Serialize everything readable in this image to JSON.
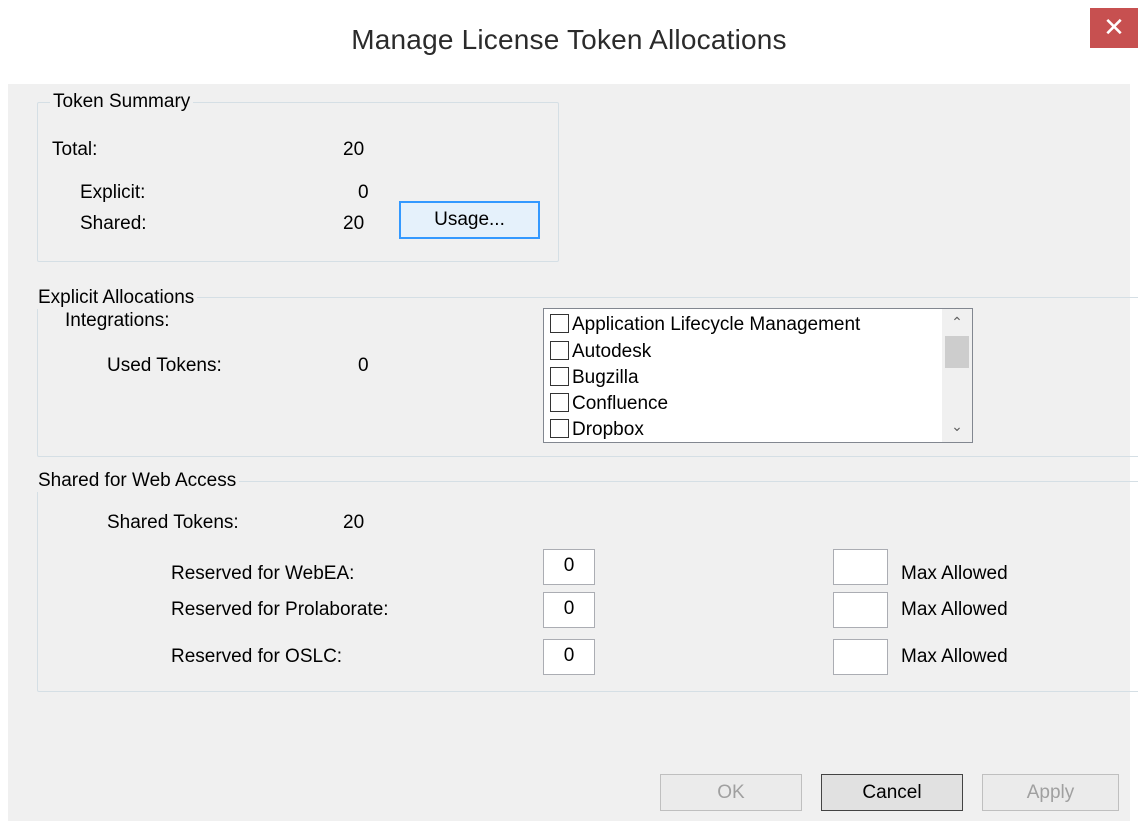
{
  "window": {
    "title": "Manage License Token Allocations",
    "close_symbol": "✕"
  },
  "token_summary": {
    "legend": "Token Summary",
    "total_label": "Total:",
    "total_value": "20",
    "explicit_label": "Explicit:",
    "explicit_value": "0",
    "shared_label": "Shared:",
    "shared_value": "20",
    "usage_button": "Usage..."
  },
  "explicit_allocations": {
    "legend": "Explicit Allocations",
    "integrations_label": "Integrations:",
    "used_tokens_label": "Used Tokens:",
    "used_tokens_value": "0",
    "integrations": [
      {
        "label": "Application Lifecycle Management",
        "checked": false
      },
      {
        "label": "Autodesk",
        "checked": false
      },
      {
        "label": "Bugzilla",
        "checked": false
      },
      {
        "label": "Confluence",
        "checked": false
      },
      {
        "label": "Dropbox",
        "checked": false
      }
    ]
  },
  "shared_web": {
    "legend": "Shared for Web Access",
    "shared_tokens_label": "Shared Tokens:",
    "shared_tokens_value": "20",
    "rows": [
      {
        "label": "Reserved for WebEA:",
        "value": "0",
        "max_value": "",
        "max_label": "Max Allowed"
      },
      {
        "label": "Reserved for Prolaborate:",
        "value": "0",
        "max_value": "",
        "max_label": "Max Allowed"
      },
      {
        "label": "Reserved for OSLC:",
        "value": "0",
        "max_value": "",
        "max_label": "Max Allowed"
      }
    ]
  },
  "buttons": {
    "ok": "OK",
    "cancel": "Cancel",
    "apply": "Apply"
  },
  "colors": {
    "close_bg": "#c75050",
    "focus_border": "#3399ff",
    "group_border": "#d5dfe5"
  }
}
